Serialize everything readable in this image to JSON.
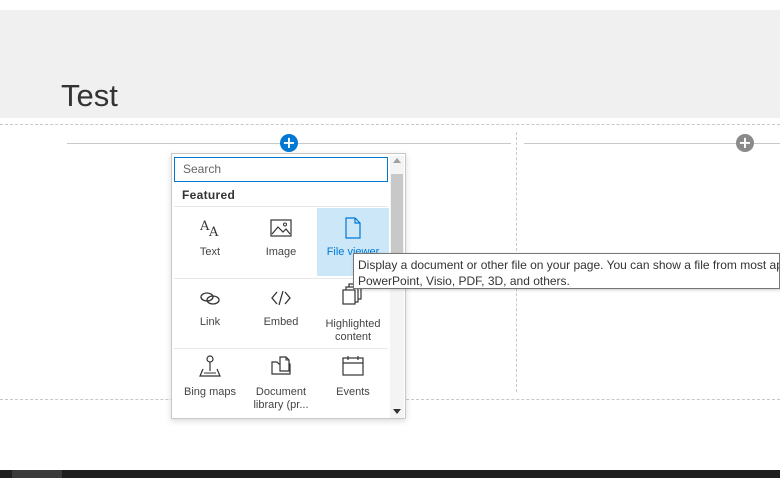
{
  "page": {
    "title": "Test"
  },
  "canvas": {
    "add_section_symbol": "+"
  },
  "picker": {
    "search_placeholder": "Search",
    "section_heading": "Featured",
    "items": [
      {
        "label": "Text",
        "icon": "text-icon"
      },
      {
        "label": "Image",
        "icon": "image-icon"
      },
      {
        "label": "File viewer",
        "icon": "file-icon",
        "selected": true
      },
      {
        "label": "Link",
        "icon": "link-icon"
      },
      {
        "label": "Embed",
        "icon": "embed-icon"
      },
      {
        "label": "Highlighted content",
        "icon": "highlighted-content-icon"
      },
      {
        "label": "Bing maps",
        "icon": "map-pin-icon"
      },
      {
        "label": "Document library (pr...",
        "icon": "document-library-icon"
      },
      {
        "label": "Events",
        "icon": "calendar-icon"
      }
    ]
  },
  "tooltip": {
    "line1": "Display a document or other file on your page. You can show a file from most apps, including Word, Excel,",
    "line2": "PowerPoint, Visio, PDF, 3D, and others."
  },
  "colors": {
    "accent": "#0078d4",
    "selected_bg": "#cce8f8",
    "header_bg": "#f0f0f0"
  }
}
